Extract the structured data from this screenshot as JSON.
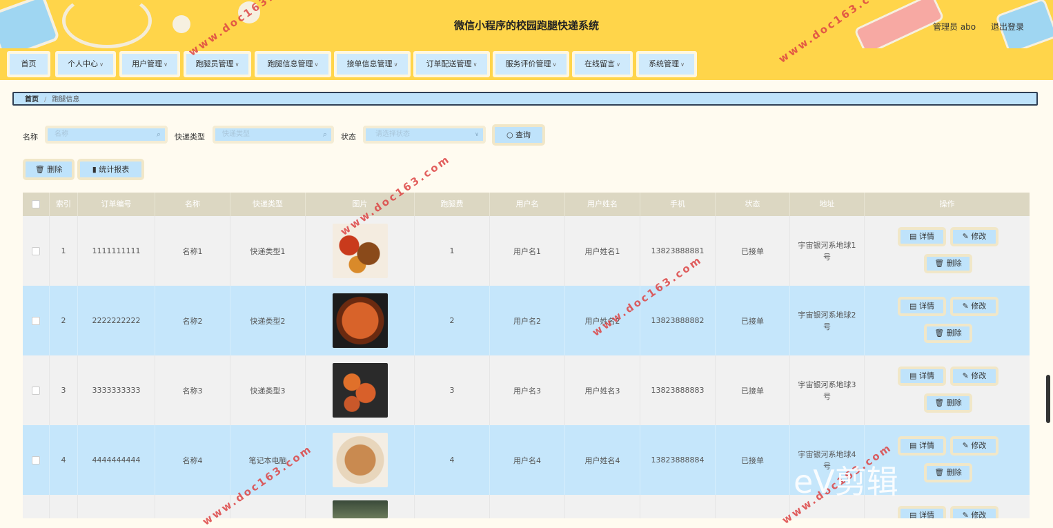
{
  "header": {
    "title": "微信小程序的校园跑腿快递系统",
    "user_label": "管理员 abo",
    "logout_label": "退出登录"
  },
  "nav": [
    {
      "label": "首页",
      "dropdown": false
    },
    {
      "label": "个人中心",
      "dropdown": true
    },
    {
      "label": "用户管理",
      "dropdown": true
    },
    {
      "label": "跑腿员管理",
      "dropdown": true
    },
    {
      "label": "跑腿信息管理",
      "dropdown": true
    },
    {
      "label": "接单信息管理",
      "dropdown": true
    },
    {
      "label": "订单配送管理",
      "dropdown": true
    },
    {
      "label": "服务评价管理",
      "dropdown": true
    },
    {
      "label": "在线留言",
      "dropdown": true
    },
    {
      "label": "系统管理",
      "dropdown": true
    }
  ],
  "breadcrumb": {
    "home": "首页",
    "current": "跑腿信息"
  },
  "search": {
    "name_label": "名称",
    "name_placeholder": "名称",
    "type_label": "快递类型",
    "type_placeholder": "快递类型",
    "status_label": "状态",
    "status_placeholder": "请选择状态",
    "query_label": "查询"
  },
  "toolbar": {
    "delete_label": "删除",
    "report_label": "统计报表"
  },
  "table": {
    "columns": [
      "索引",
      "订单编号",
      "名称",
      "快递类型",
      "图片",
      "跑腿费",
      "用户名",
      "用户姓名",
      "手机",
      "状态",
      "地址",
      "操作"
    ],
    "rows": [
      {
        "index": "1",
        "order_no": "1111111111",
        "name": "名称1",
        "type": "快递类型1",
        "fee": "1",
        "username": "用户名1",
        "realname": "用户姓名1",
        "phone": "13823888881",
        "status": "已接单",
        "address": "宇宙银河系地球1号"
      },
      {
        "index": "2",
        "order_no": "2222222222",
        "name": "名称2",
        "type": "快递类型2",
        "fee": "2",
        "username": "用户名2",
        "realname": "用户姓名2",
        "phone": "13823888882",
        "status": "已接单",
        "address": "宇宙银河系地球2号"
      },
      {
        "index": "3",
        "order_no": "3333333333",
        "name": "名称3",
        "type": "快递类型3",
        "fee": "3",
        "username": "用户名3",
        "realname": "用户姓名3",
        "phone": "13823888883",
        "status": "已接单",
        "address": "宇宙银河系地球3号"
      },
      {
        "index": "4",
        "order_no": "4444444444",
        "name": "名称4",
        "type": "笔记本电脑",
        "fee": "4",
        "username": "用户名4",
        "realname": "用户姓名4",
        "phone": "13823888884",
        "status": "已接单",
        "address": "宇宙银河系地球4号"
      }
    ],
    "actions": {
      "detail": "详情",
      "edit": "修改",
      "delete": "删除"
    }
  },
  "overlay": {
    "watermark": "www.doc163.com",
    "editor_logo": "eV剪辑"
  },
  "colors": {
    "header_bg": "#ffd54a",
    "button_bg": "#bfe3fb",
    "page_bg": "#fffbf0",
    "row_alt": "#c5e6fb"
  }
}
